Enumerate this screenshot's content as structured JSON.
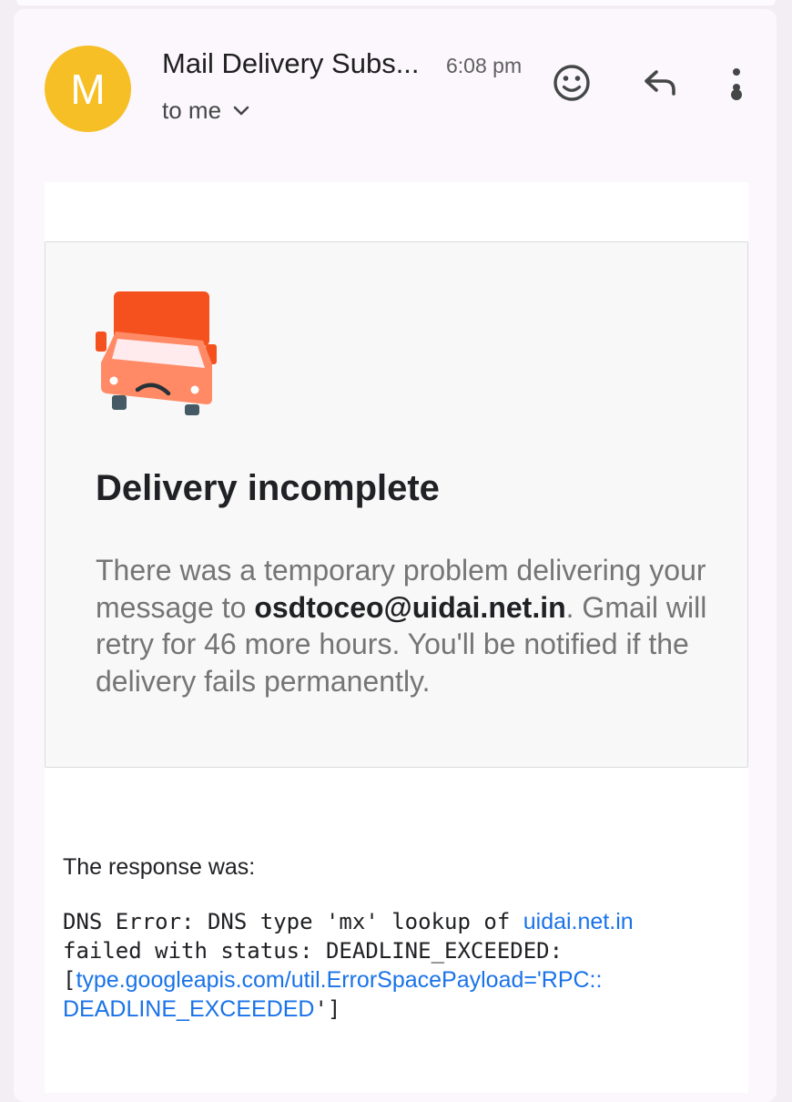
{
  "header": {
    "avatar_letter": "M",
    "avatar_color": "#f6bf26",
    "sender": "Mail Delivery Subs...",
    "time": "6:08 pm",
    "recipient": "to me",
    "icons": [
      "emoji-reaction-icon",
      "reply-icon",
      "more-vert-icon"
    ]
  },
  "notice": {
    "illustration": "sad-truck-icon",
    "title": "Delivery incomplete",
    "text_1": "There was a temporary problem delivering your message to ",
    "recipient_email": "osdtoceo@uidai.net.in",
    "text_2": ". Gmail will retry for 46 more hours. You'll be notified if the delivery fails permanently."
  },
  "response": {
    "label": "The response was:",
    "line1_text": "DNS Error: DNS type 'mx' lookup of ",
    "line1_link": "uidai.net.in",
    "line2_text": "failed with status: DEADLINE_EXCEEDED:",
    "line3_open": "[",
    "line3_link": "type.googleapis.com/util.ErrorSpacePayload='RPC::",
    "line4_link": "DEADLINE_EXCEEDED",
    "line4_close": "']",
    "link_color": "#1a73e8"
  }
}
